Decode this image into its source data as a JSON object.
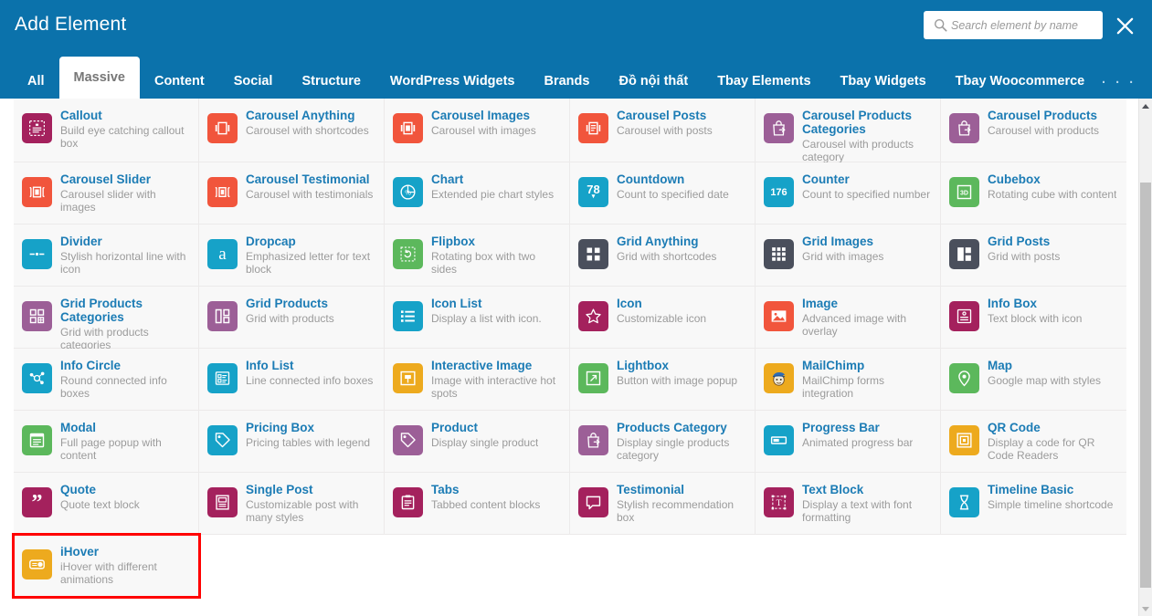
{
  "header": {
    "title": "Add Element",
    "search": {
      "placeholder": "Search element by name",
      "value": "",
      "icon": "search-icon"
    },
    "close_icon": "close-icon",
    "overflow_label": ". . ."
  },
  "tabs": [
    {
      "label": "All",
      "active": false
    },
    {
      "label": "Massive",
      "active": true
    },
    {
      "label": "Content",
      "active": false
    },
    {
      "label": "Social",
      "active": false
    },
    {
      "label": "Structure",
      "active": false
    },
    {
      "label": "WordPress Widgets",
      "active": false
    },
    {
      "label": "Brands",
      "active": false
    },
    {
      "label": "Đồ nội thất",
      "active": false
    },
    {
      "label": "Tbay Elements",
      "active": false
    },
    {
      "label": "Tbay Widgets",
      "active": false
    },
    {
      "label": "Tbay Woocommerce",
      "active": false
    }
  ],
  "colors": {
    "header_blue": "#0b72ab",
    "title_blue": "#1c7cb5",
    "desc_gray": "#9b9b9b",
    "selection_red": "#ff0000",
    "crimson": "#a4215d",
    "magenta": "#9c5f97",
    "orange_red": "#f1553c",
    "cyan": "#16a2c8",
    "green": "#5cb85c",
    "amber": "#edaa1e",
    "dark_slate": "#4a4f5c"
  },
  "elements": [
    {
      "title": "Callout",
      "desc": "Build eye catching callout box",
      "icon": "callout-icon",
      "color": "#a4215d"
    },
    {
      "title": "Carousel Anything",
      "desc": "Carousel with shortcodes",
      "icon": "carousel-anything-icon",
      "color": "#f1553c"
    },
    {
      "title": "Carousel Images",
      "desc": "Carousel with images",
      "icon": "carousel-images-icon",
      "color": "#f1553c"
    },
    {
      "title": "Carousel Posts",
      "desc": "Carousel with posts",
      "icon": "carousel-posts-icon",
      "color": "#f1553c"
    },
    {
      "title": "Carousel Products Categories",
      "desc": "Carousel with products category",
      "icon": "bag-arrow-icon",
      "color": "#9c5f97"
    },
    {
      "title": "Carousel Products",
      "desc": "Carousel with products",
      "icon": "bag-arrow-icon",
      "color": "#9c5f97"
    },
    {
      "title": "Carousel Slider",
      "desc": "Carousel slider with images",
      "icon": "carousel-slider-icon",
      "color": "#f1553c"
    },
    {
      "title": "Carousel Testimonial",
      "desc": "Carousel with testimonials",
      "icon": "carousel-testimonial-icon",
      "color": "#f1553c"
    },
    {
      "title": "Chart",
      "desc": "Extended pie chart styles",
      "icon": "percent-circle-icon",
      "color": "#16a2c8"
    },
    {
      "title": "Countdown",
      "desc": "Count to specified date",
      "icon": "countdown-78-icon",
      "color": "#16a2c8"
    },
    {
      "title": "Counter",
      "desc": "Count to specified number",
      "icon": "counter-176-icon",
      "color": "#16a2c8"
    },
    {
      "title": "Cubebox",
      "desc": "Rotating cube with content",
      "icon": "cube-3d-icon",
      "color": "#5cb85c"
    },
    {
      "title": "Divider",
      "desc": "Stylish horizontal line with icon",
      "icon": "divider-icon",
      "color": "#16a2c8"
    },
    {
      "title": "Dropcap",
      "desc": "Emphasized letter for text block",
      "icon": "dropcap-a-icon",
      "color": "#16a2c8"
    },
    {
      "title": "Flipbox",
      "desc": "Rotating box with two sides",
      "icon": "flipbox-icon",
      "color": "#5cb85c"
    },
    {
      "title": "Grid Anything",
      "desc": "Grid with shortcodes",
      "icon": "grid-anything-icon",
      "color": "#4a4f5c"
    },
    {
      "title": "Grid Images",
      "desc": "Grid with images",
      "icon": "grid-images-icon",
      "color": "#4a4f5c"
    },
    {
      "title": "Grid Posts",
      "desc": "Grid with posts",
      "icon": "grid-posts-icon",
      "color": "#4a4f5c"
    },
    {
      "title": "Grid Products Categories",
      "desc": "Grid with products categories",
      "icon": "grid-products-categories-icon",
      "color": "#9c5f97"
    },
    {
      "title": "Grid Products",
      "desc": "Grid with products",
      "icon": "grid-products-icon",
      "color": "#9c5f97"
    },
    {
      "title": "Icon List",
      "desc": "Display a list with icon.",
      "icon": "icon-list-icon",
      "color": "#16a2c8"
    },
    {
      "title": "Icon",
      "desc": "Customizable icon",
      "icon": "star-icon",
      "color": "#a4215d"
    },
    {
      "title": "Image",
      "desc": "Advanced image with overlay",
      "icon": "image-icon",
      "color": "#f1553c"
    },
    {
      "title": "Info Box",
      "desc": "Text block with icon",
      "icon": "info-box-icon",
      "color": "#a4215d"
    },
    {
      "title": "Info Circle",
      "desc": "Round connected info boxes",
      "icon": "info-circle-icon",
      "color": "#16a2c8"
    },
    {
      "title": "Info List",
      "desc": "Line connected info boxes",
      "icon": "info-list-icon",
      "color": "#16a2c8"
    },
    {
      "title": "Interactive Image",
      "desc": "Image with interactive hot spots",
      "icon": "interactive-image-icon",
      "color": "#edaa1e"
    },
    {
      "title": "Lightbox",
      "desc": "Button with image popup",
      "icon": "lightbox-expand-icon",
      "color": "#5cb85c"
    },
    {
      "title": "MailChimp",
      "desc": "MailChimp forms integration",
      "icon": "mailchimp-monkey-icon",
      "color": "#edaa1e"
    },
    {
      "title": "Map",
      "desc": "Google map with styles",
      "icon": "map-pin-icon",
      "color": "#5cb85c"
    },
    {
      "title": "Modal",
      "desc": "Full page popup with content",
      "icon": "modal-icon",
      "color": "#5cb85c"
    },
    {
      "title": "Pricing Box",
      "desc": "Pricing tables with legend",
      "icon": "price-tag-icon",
      "color": "#16a2c8"
    },
    {
      "title": "Product",
      "desc": "Display single product",
      "icon": "price-tag-icon",
      "color": "#9c5f97"
    },
    {
      "title": "Products Category",
      "desc": "Display single products category",
      "icon": "bag-arrow-icon",
      "color": "#9c5f97"
    },
    {
      "title": "Progress Bar",
      "desc": "Animated progress bar",
      "icon": "progress-bar-icon",
      "color": "#16a2c8"
    },
    {
      "title": "QR Code",
      "desc": "Display a code for QR Code Readers",
      "icon": "qr-code-icon",
      "color": "#edaa1e"
    },
    {
      "title": "Quote",
      "desc": "Quote text block",
      "icon": "quote-icon",
      "color": "#a4215d"
    },
    {
      "title": "Single Post",
      "desc": "Customizable post with many styles",
      "icon": "single-post-icon",
      "color": "#a4215d"
    },
    {
      "title": "Tabs",
      "desc": "Tabbed content blocks",
      "icon": "tabs-icon",
      "color": "#a4215d"
    },
    {
      "title": "Testimonial",
      "desc": "Stylish recommendation box",
      "icon": "testimonial-icon",
      "color": "#a4215d"
    },
    {
      "title": "Text Block",
      "desc": "Display a text with font formatting",
      "icon": "text-block-icon",
      "color": "#a4215d"
    },
    {
      "title": "Timeline Basic",
      "desc": "Simple timeline shortcode",
      "icon": "hourglass-icon",
      "color": "#16a2c8"
    },
    {
      "title": "iHover",
      "desc": "iHover with different animations",
      "icon": "ihover-icon",
      "color": "#edaa1e",
      "selected": true
    }
  ]
}
